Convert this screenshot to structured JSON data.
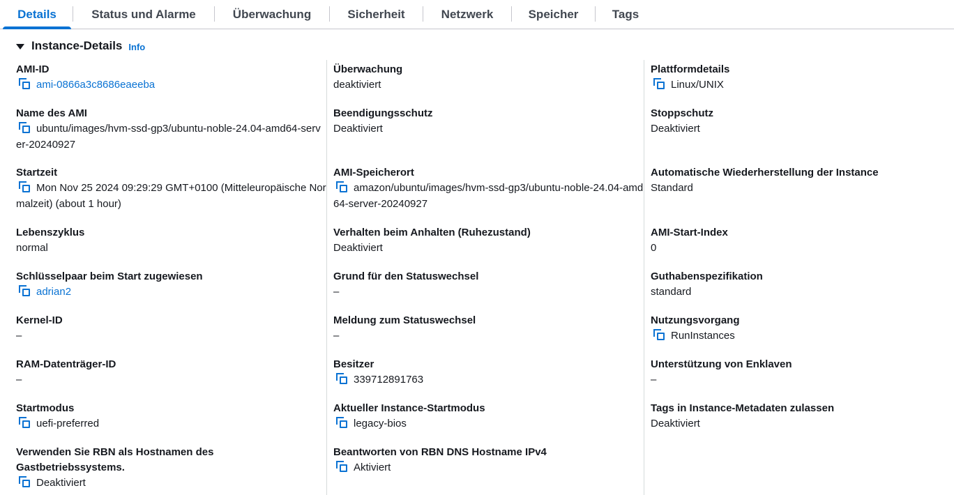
{
  "tabs": [
    "Details",
    "Status und Alarme",
    "Überwachung",
    "Sicherheit",
    "Netzwerk",
    "Speicher",
    "Tags"
  ],
  "section": {
    "title": "Instance-Details",
    "info": "Info"
  },
  "col1": [
    {
      "label": "AMI-ID",
      "value": "ami-0866a3c8686eaeeba"
    },
    {
      "label": "Name des AMI",
      "value": "ubuntu/images/hvm-ssd-gp3/ubuntu-noble-24.04-amd64-server-20240927"
    },
    {
      "label": "Startzeit",
      "value": "Mon Nov 25 2024 09:29:29 GMT+0100 (Mitteleuropäische Normalzeit) (about 1 hour)"
    },
    {
      "label": "Lebenszyklus",
      "value": "normal"
    },
    {
      "label": "Schlüsselpaar beim Start zugewiesen",
      "value": "adrian2"
    },
    {
      "label": "Kernel-ID",
      "value": "–"
    },
    {
      "label": "RAM-Datenträger-ID",
      "value": "–"
    },
    {
      "label": "Startmodus",
      "value": "uefi-preferred"
    },
    {
      "label": "Verwenden Sie RBN als Hostnamen des Gastbetriebssystems.",
      "value": "Deaktiviert"
    }
  ],
  "col2": [
    {
      "label": "Überwachung",
      "value": "deaktiviert"
    },
    {
      "label": "Beendigungsschutz",
      "value": "Deaktiviert"
    },
    {
      "label": "AMI-Speicherort",
      "value": "amazon/ubuntu/images/hvm-ssd-gp3/ubuntu-noble-24.04-amd64-server-20240927"
    },
    {
      "label": "Verhalten beim Anhalten (Ruhezustand)",
      "value": "Deaktiviert"
    },
    {
      "label": "Grund für den Statuswechsel",
      "value": "–"
    },
    {
      "label": "Meldung zum Statuswechsel",
      "value": "–"
    },
    {
      "label": "Besitzer",
      "value": "339712891763"
    },
    {
      "label": "Aktueller Instance-Startmodus",
      "value": "legacy-bios"
    },
    {
      "label": "Beantworten von RBN DNS Hostname IPv4",
      "value": "Aktiviert"
    }
  ],
  "col3": [
    {
      "label": "Plattformdetails",
      "value": "Linux/UNIX"
    },
    {
      "label": "Stoppschutz",
      "value": "Deaktiviert"
    },
    {
      "label": "Automatische Wiederherstellung der Instance",
      "value": "Standard"
    },
    {
      "label": "AMI-Start-Index",
      "value": "0"
    },
    {
      "label": "Guthabenspezifikation",
      "value": "standard"
    },
    {
      "label": "Nutzungsvorgang",
      "value": "RunInstances"
    },
    {
      "label": "Unterstützung von Enklaven",
      "value": "–"
    },
    {
      "label": "Tags in Instance-Metadaten zulassen",
      "value": "Deaktiviert"
    }
  ],
  "colors": {
    "accent": "#0972d3",
    "text": "#16191f",
    "tab_text": "#414750",
    "divider": "#d5dbdb"
  },
  "icons": {
    "copy": "copy-icon",
    "caret": "caret-down-icon"
  }
}
